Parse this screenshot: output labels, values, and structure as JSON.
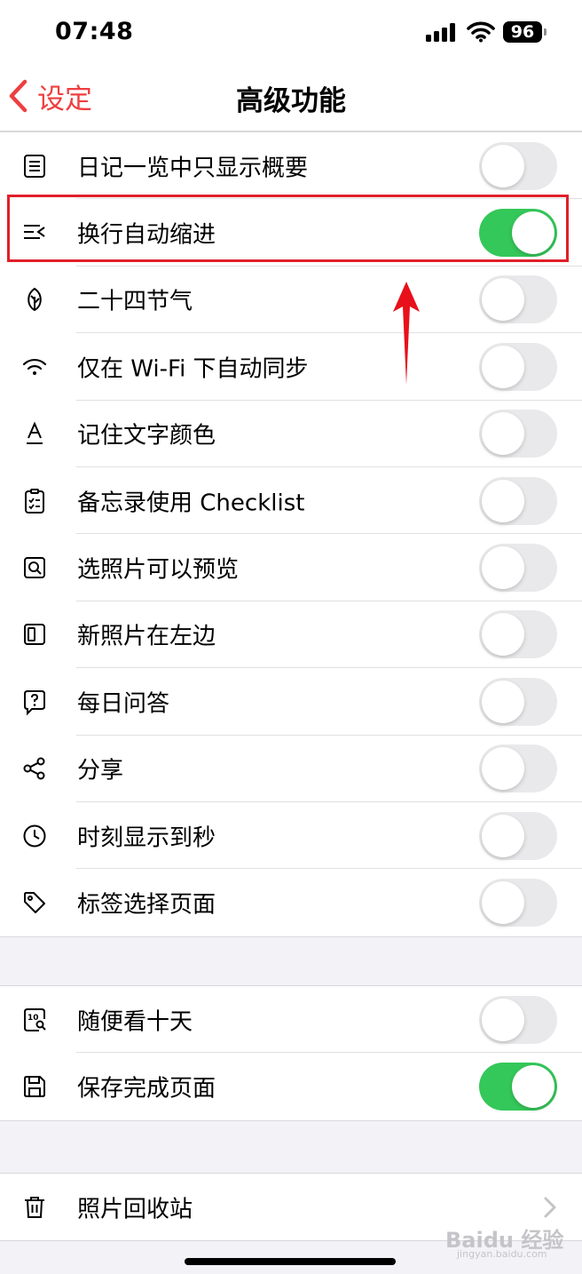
{
  "status_bar": {
    "time": "07:48",
    "battery": "96"
  },
  "nav": {
    "back_label": "设定",
    "title": "高级功能"
  },
  "group1": [
    {
      "label": "日记一览中只显示概要",
      "icon": "list-icon",
      "on": false
    },
    {
      "label": "换行自动缩进",
      "icon": "indent-icon",
      "on": true
    },
    {
      "label": "二十四节气",
      "icon": "leaf-icon",
      "on": false
    },
    {
      "label": "仅在 Wi-Fi 下自动同步",
      "icon": "wifi-icon",
      "on": false
    },
    {
      "label": "记住文字颜色",
      "icon": "text-color-icon",
      "on": false
    },
    {
      "label": "备忘录使用 Checklist",
      "icon": "clipboard-check-icon",
      "on": false
    },
    {
      "label": "选照片可以预览",
      "icon": "photo-search-icon",
      "on": false
    },
    {
      "label": "新照片在左边",
      "icon": "left-panel-icon",
      "on": false
    },
    {
      "label": "每日问答",
      "icon": "question-bubble-icon",
      "on": false
    },
    {
      "label": "分享",
      "icon": "share-icon",
      "on": false
    },
    {
      "label": "时刻显示到秒",
      "icon": "clock-icon",
      "on": false
    },
    {
      "label": "标签选择页面",
      "icon": "tag-icon",
      "on": false
    }
  ],
  "group2": [
    {
      "label": "随便看十天",
      "icon": "ten-days-icon",
      "on": false
    },
    {
      "label": "保存完成页面",
      "icon": "save-icon",
      "on": true
    }
  ],
  "group3": [
    {
      "label": "照片回收站",
      "icon": "trash-icon"
    }
  ],
  "colors": {
    "accent": "#ef3e3e",
    "toggle_on": "#34c759",
    "highlight": "#e0202a"
  },
  "watermark": {
    "text": "Baidu 经验",
    "sub": "jingyan.baidu.com"
  }
}
